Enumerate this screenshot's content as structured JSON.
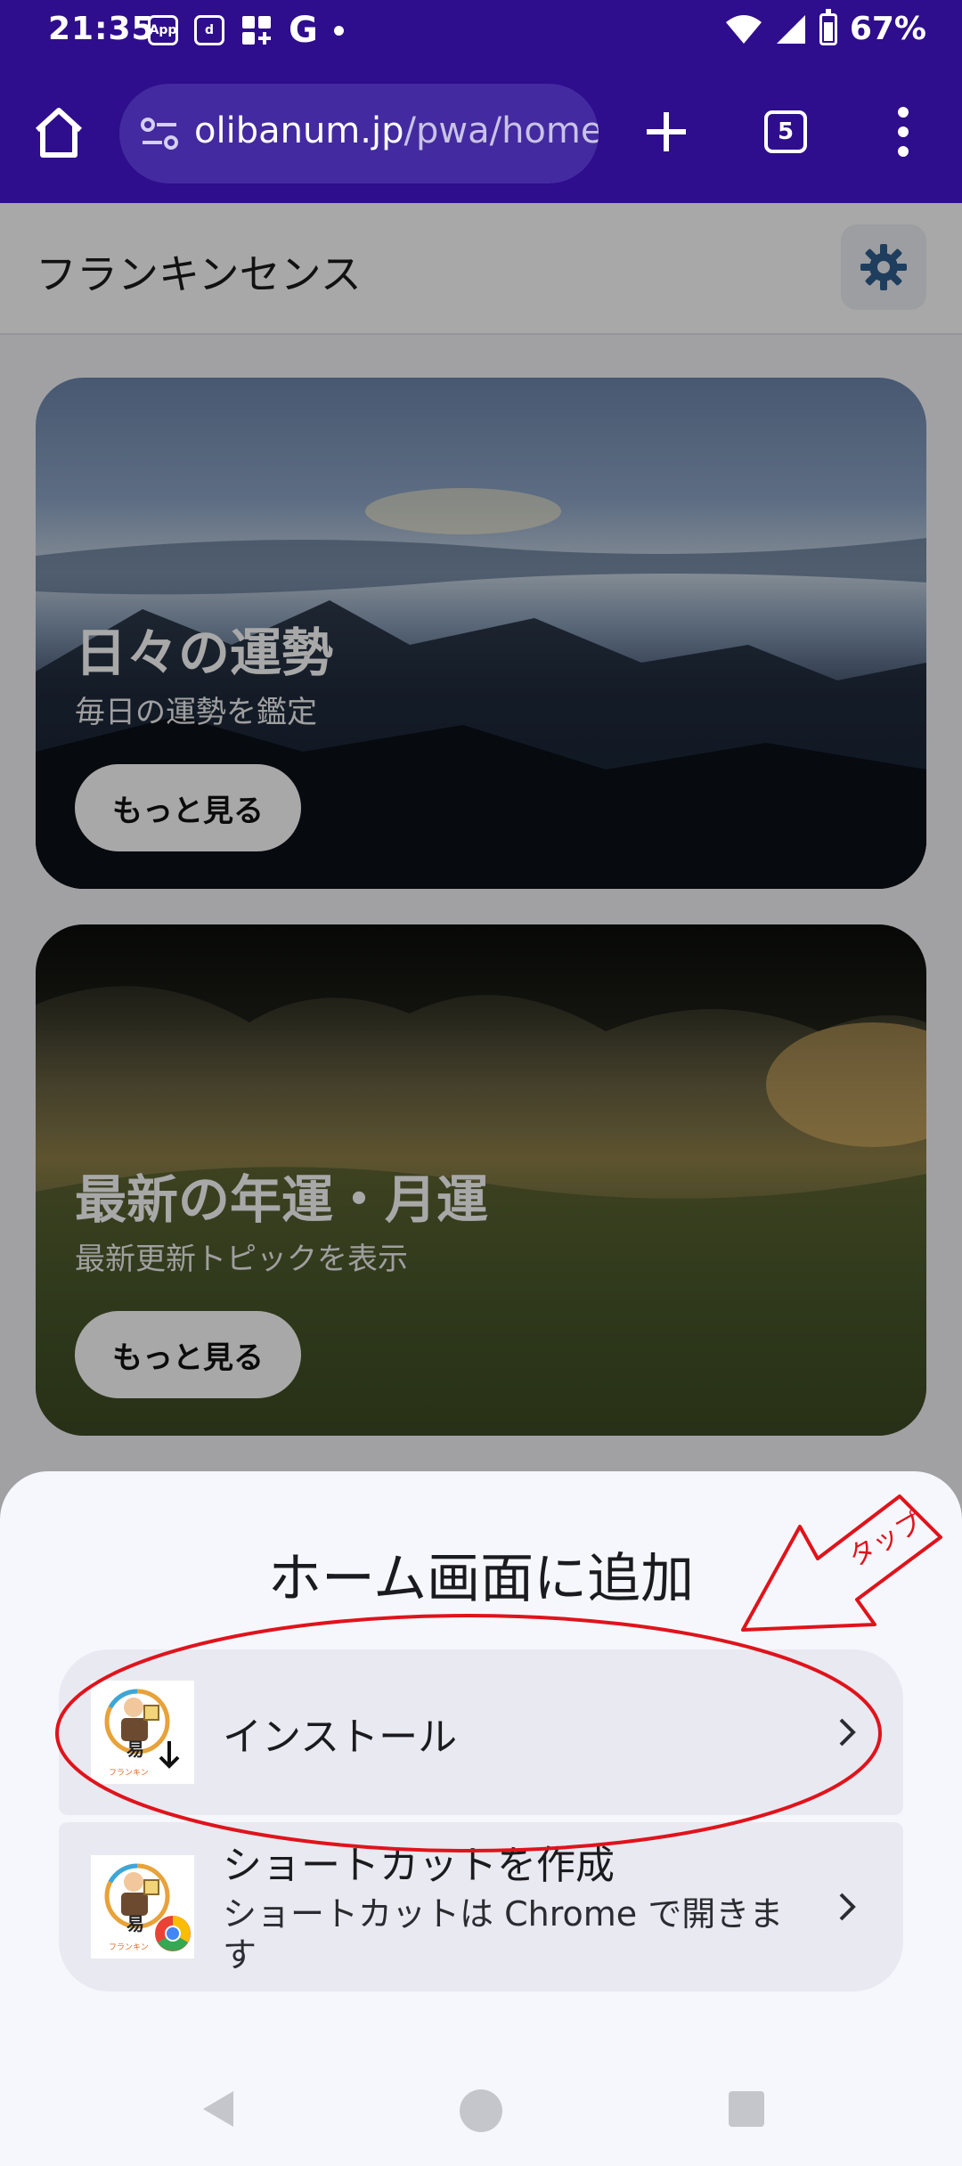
{
  "status_bar": {
    "time": "21:35",
    "battery_percent": "67%",
    "battery_level": 0.67,
    "icons": [
      "app-icon",
      "d-icon",
      "widgets-icon",
      "google-icon",
      "dot-icon",
      "wifi-icon",
      "signal-icon",
      "battery-icon"
    ]
  },
  "browser": {
    "url_host": "olibanum.jp",
    "url_path": "/pwa/home",
    "tab_count": "5",
    "toolbar_color": "#2e0e8c"
  },
  "page": {
    "title": "フランキンセンス",
    "cards": [
      {
        "title": "日々の運勢",
        "subtitle": "毎日の運勢を鑑定",
        "button": "もっと見る"
      },
      {
        "title": "最新の年運・月運",
        "subtitle": "最新更新トピックを表示",
        "button": "もっと見る"
      }
    ]
  },
  "sheet": {
    "title": "ホーム画面に追加",
    "options": [
      {
        "label": "インストール"
      },
      {
        "label": "ショートカットを作成",
        "description": "ショートカットは Chrome で開きます"
      }
    ],
    "icon_caption": "フランキン"
  },
  "annotation": {
    "text": "タップ",
    "color": "#e0131b"
  }
}
